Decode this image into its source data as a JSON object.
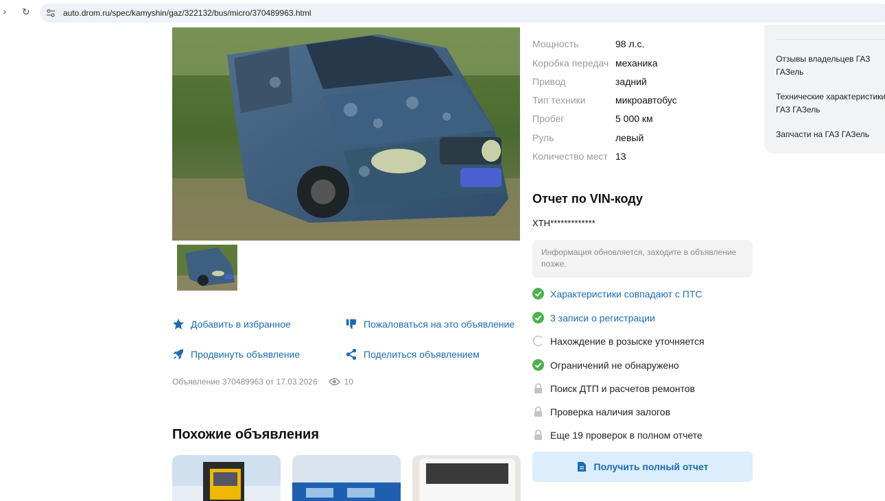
{
  "browser": {
    "url": "auto.drom.ru/spec/kamyshin/gaz/322132/bus/micro/370489963.html",
    "overlay_text": "Поиск ДТП и расчетов ремонтов"
  },
  "specs": [
    {
      "key": "Мощность",
      "value": "98 л.с."
    },
    {
      "key": "Коробка передач",
      "value": "механика"
    },
    {
      "key": "Привод",
      "value": "задний"
    },
    {
      "key": "Тип техники",
      "value": "микроавтобус"
    },
    {
      "key": "Пробег",
      "value": "5 000 км"
    },
    {
      "key": "Руль",
      "value": "левый"
    },
    {
      "key": "Количество мест",
      "value": "13"
    }
  ],
  "actions": {
    "favorite": "Добавить в избранное",
    "complain": "Пожаловаться на это объявление",
    "promote": "Продвинуть объявление",
    "share": "Поделиться объявлением"
  },
  "listing_meta": {
    "info": "Объявление 370489963 от 17.03.2026",
    "views": "10"
  },
  "similar": {
    "title": "Похожие объявления"
  },
  "vin": {
    "title": "Отчет по VIN-коду",
    "code": "XTH*************",
    "info": "Информация обновляется, заходите в объявление позже.",
    "checks": [
      {
        "label": "Характеристики совпадают с ПТС",
        "status": "ok"
      },
      {
        "label": "3 записи о регистрации",
        "status": "ok"
      },
      {
        "label": "Нахождение в розыске уточняется",
        "status": "pending"
      },
      {
        "label": "Ограничений не обнаружено",
        "status": "ok"
      },
      {
        "label": "Поиск ДТП и расчетов ремонтов",
        "status": "locked"
      },
      {
        "label": "Проверка наличия залогов",
        "status": "locked"
      },
      {
        "label": "Еще 19 проверок в полном отчете",
        "status": "locked"
      }
    ],
    "button": "Получить полный отчет"
  },
  "sidebar": {
    "links": [
      "Отзывы владельцев ГАЗ ГАЗель",
      "Технические характеристики ГАЗ ГАЗель",
      "Запчасти на ГАЗ ГАЗель"
    ]
  },
  "colors": {
    "link": "#1a6bb3",
    "ok_green": "#4bb34b",
    "locked_gray": "#c4c4c4",
    "button_bg": "#dcedfb"
  }
}
